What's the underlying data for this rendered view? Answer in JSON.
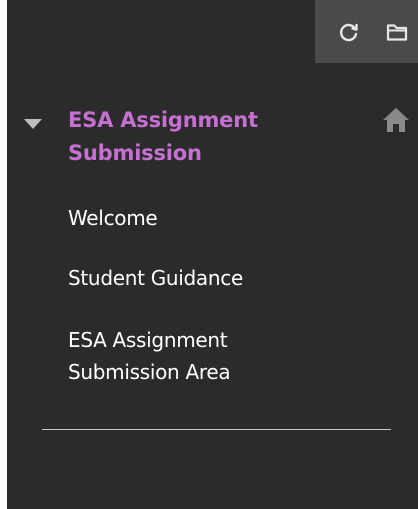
{
  "toolbar": {
    "refresh_icon": "refresh-icon",
    "folder_icon": "folder-icon"
  },
  "course": {
    "title": "ESA Assignment Submission",
    "expanded": true,
    "home_icon": "home-icon",
    "accent_color": "#c86fd4"
  },
  "menu": {
    "items": [
      {
        "label": "Welcome"
      },
      {
        "label": "Student Guidance"
      },
      {
        "label": "ESA Assignment Submission Area"
      }
    ]
  },
  "colors": {
    "panel_background": "#2b2b2b",
    "toolbar_background": "#4a4a4a",
    "text": "#ffffff",
    "divider": "#c8c8c8"
  }
}
